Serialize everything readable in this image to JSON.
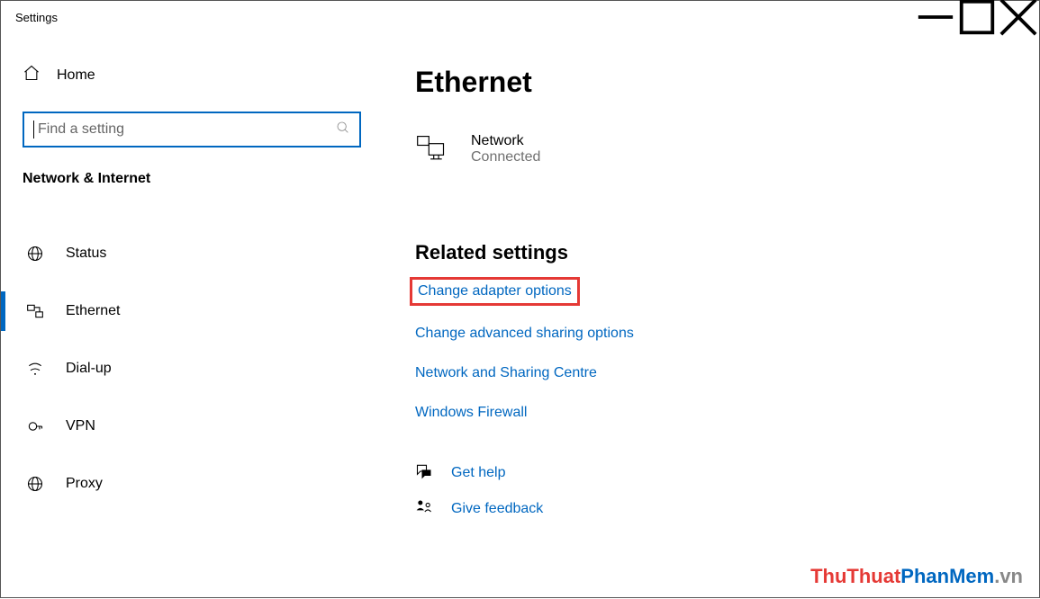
{
  "window": {
    "title": "Settings"
  },
  "sidebar": {
    "home_label": "Home",
    "search_placeholder": "Find a setting",
    "category_label": "Network & Internet",
    "items": [
      {
        "label": "Status",
        "icon": "globe-icon",
        "active": false
      },
      {
        "label": "Ethernet",
        "icon": "ethernet-icon",
        "active": true
      },
      {
        "label": "Dial-up",
        "icon": "dialup-icon",
        "active": false
      },
      {
        "label": "VPN",
        "icon": "vpn-icon",
        "active": false
      },
      {
        "label": "Proxy",
        "icon": "proxy-icon",
        "active": false
      }
    ]
  },
  "main": {
    "title": "Ethernet",
    "network": {
      "name": "Network",
      "status": "Connected"
    },
    "related_title": "Related settings",
    "related_links": [
      {
        "label": "Change adapter options",
        "highlighted": true
      },
      {
        "label": "Change advanced sharing options",
        "highlighted": false
      },
      {
        "label": "Network and Sharing Centre",
        "highlighted": false
      },
      {
        "label": "Windows Firewall",
        "highlighted": false
      }
    ],
    "help_links": [
      {
        "label": "Get help",
        "icon": "chat-icon"
      },
      {
        "label": "Give feedback",
        "icon": "feedback-icon"
      }
    ]
  },
  "watermark": {
    "a": "ThuThuat",
    "b": "PhanMem",
    "c": ".vn"
  }
}
